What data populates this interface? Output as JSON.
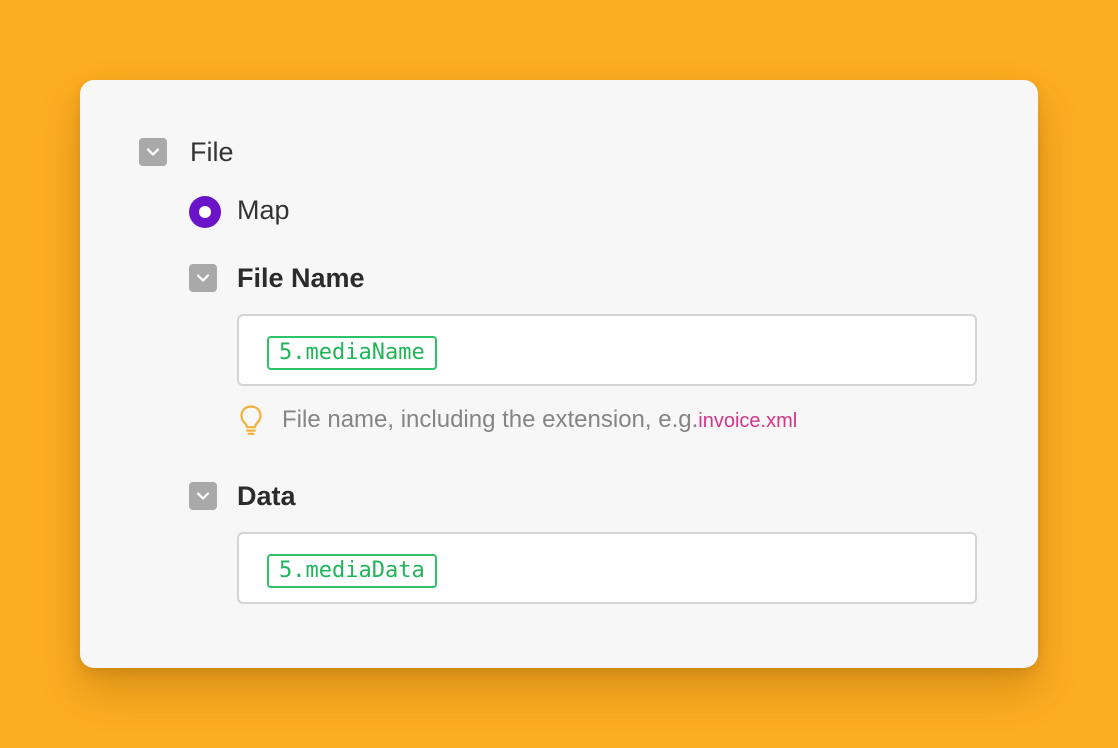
{
  "file": {
    "label": "File"
  },
  "map": {
    "label": "Map"
  },
  "file_name": {
    "label": "File Name",
    "value": "5.mediaName",
    "hint": "File name, including the extension, e.g.",
    "hint_example": "invoice.xml"
  },
  "data": {
    "label": "Data",
    "value": "5.mediaData"
  },
  "colors": {
    "background": "#fdad21",
    "radio": "#6a13c9",
    "pill": "#2ec26a",
    "hint_example": "#d3358a"
  },
  "icons": {
    "toggle": "chevron-down-icon",
    "hint": "lightbulb-icon"
  }
}
